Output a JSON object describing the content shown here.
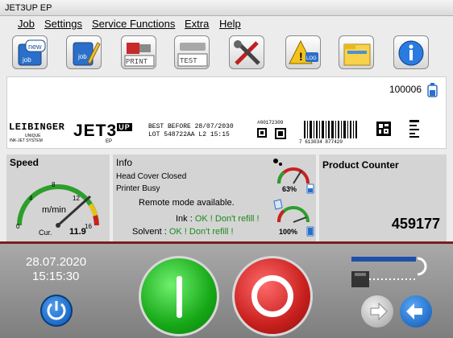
{
  "window": {
    "title": "JET3UP EP"
  },
  "menu": {
    "items": [
      "Job",
      "Settings",
      "Service Functions",
      "Extra",
      "Help"
    ]
  },
  "toolbar": {
    "buttons": [
      {
        "name": "new-job-button",
        "icon": "new-job-icon",
        "label": "new",
        "sublabel": "job"
      },
      {
        "name": "edit-job-button",
        "icon": "edit-job-icon",
        "label": "job"
      },
      {
        "name": "print-button",
        "icon": "print-icon",
        "label": "PRINT"
      },
      {
        "name": "test-button",
        "icon": "test-icon",
        "label": "TEST"
      },
      {
        "name": "service-tools-button",
        "icon": "tools-icon"
      },
      {
        "name": "log-button",
        "icon": "warning-log-icon",
        "label": "LOG"
      },
      {
        "name": "folder-button",
        "icon": "folder-icon"
      },
      {
        "name": "info-button",
        "icon": "info-icon"
      }
    ]
  },
  "print_preview": {
    "counter": "100006",
    "brand": "LEIBINGER",
    "brand_tag1": "UNIQUE",
    "brand_tag2": "INK-JET SYSTEM",
    "logo": "JET3",
    "logo_sup": "UP",
    "logo_sub": "EP",
    "best_before_line": "BEST BEFORE 28/07/2030",
    "lot_line": "LOT 548722AA   L2 15:15",
    "code_number": "#00172309",
    "barcode_number": "7 613034 877420"
  },
  "speed": {
    "title": "Speed",
    "unit": "m/min",
    "scale": [
      "0",
      "4",
      "8",
      "12",
      "16"
    ],
    "current_label": "Cur.",
    "current_value": "11.9",
    "level": 0.74
  },
  "info": {
    "title": "Info",
    "line1": "Head Cover Closed",
    "line2": "Printer Busy",
    "remote": "Remote mode available.",
    "ink_label": "Ink : ",
    "ink_status": "OK ! Don't refill !",
    "solvent_label": "Solvent : ",
    "solvent_status": "OK ! Don't refill !",
    "ink_level": "63%",
    "solvent_level": "100%"
  },
  "counter": {
    "title": "Product Counter",
    "value": "459177"
  },
  "status": {
    "date": "28.07.2020",
    "time": "15:15:30"
  },
  "colors": {
    "accent": "#0b57b5",
    "ok_green": "#1d8a1d",
    "start_green": "#22b522",
    "stop_red": "#c8201e",
    "separator": "#7a1f1f"
  }
}
